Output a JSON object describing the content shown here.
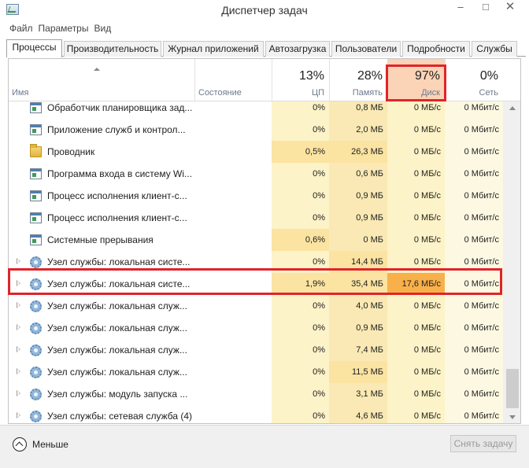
{
  "window": {
    "title": "Диспетчер задач",
    "minimize_glyph": "–",
    "maximize_glyph": "□",
    "close_glyph": "✕"
  },
  "menu": [
    "Файл",
    "Параметры",
    "Вид"
  ],
  "tabs": [
    "Процессы",
    "Производительность",
    "Журнал приложений",
    "Автозагрузка",
    "Пользователи",
    "Подробности",
    "Службы"
  ],
  "active_tab": "Процессы",
  "columns": {
    "name": "Имя",
    "status": "Состояние",
    "cpu": {
      "percent": "13%",
      "label": "ЦП"
    },
    "memory": {
      "percent": "28%",
      "label": "Память"
    },
    "disk": {
      "percent": "97%",
      "label": "Диск"
    },
    "network": {
      "percent": "0%",
      "label": "Сеть"
    }
  },
  "rows": [
    {
      "name": "Обработчик планировщика зад...",
      "icon": "app-window-icon",
      "expandable": false,
      "cpu": "0%",
      "memory": "0,8 МБ",
      "disk": "0 МБ/с",
      "network": "0 Мбит/с"
    },
    {
      "name": "Приложение служб и контрол...",
      "icon": "app-window-icon",
      "expandable": false,
      "cpu": "0%",
      "memory": "2,0 МБ",
      "disk": "0 МБ/с",
      "network": "0 Мбит/с"
    },
    {
      "name": "Проводник",
      "icon": "folder-icon",
      "expandable": false,
      "cpu": "0,5%",
      "memory": "26,3 МБ",
      "disk": "0 МБ/с",
      "network": "0 Мбит/с"
    },
    {
      "name": "Программа входа в систему Wi...",
      "icon": "app-window-icon",
      "expandable": false,
      "cpu": "0%",
      "memory": "0,6 МБ",
      "disk": "0 МБ/с",
      "network": "0 Мбит/с"
    },
    {
      "name": "Процесс исполнения клиент-с...",
      "icon": "app-window-icon",
      "expandable": false,
      "cpu": "0%",
      "memory": "0,9 МБ",
      "disk": "0 МБ/с",
      "network": "0 Мбит/с"
    },
    {
      "name": "Процесс исполнения клиент-с...",
      "icon": "app-window-icon",
      "expandable": false,
      "cpu": "0%",
      "memory": "0,9 МБ",
      "disk": "0 МБ/с",
      "network": "0 Мбит/с"
    },
    {
      "name": "Системные прерывания",
      "icon": "app-window-icon",
      "expandable": false,
      "cpu": "0,6%",
      "memory": "0 МБ",
      "disk": "0 МБ/с",
      "network": "0 Мбит/с"
    },
    {
      "name": "Узел службы: локальная систе...",
      "icon": "gear-icon",
      "expandable": true,
      "cpu": "0%",
      "memory": "14,4 МБ",
      "disk": "0 МБ/с",
      "network": "0 Мбит/с"
    },
    {
      "name": "Узел службы: локальная систе...",
      "icon": "gear-icon",
      "expandable": true,
      "cpu": "1,9%",
      "memory": "35,4 МБ",
      "disk": "17,6 МБ/с",
      "network": "0 Мбит/с"
    },
    {
      "name": "Узел службы: локальная служ...",
      "icon": "gear-icon",
      "expandable": true,
      "cpu": "0%",
      "memory": "4,0 МБ",
      "disk": "0 МБ/с",
      "network": "0 Мбит/с"
    },
    {
      "name": "Узел службы: локальная служ...",
      "icon": "gear-icon",
      "expandable": true,
      "cpu": "0%",
      "memory": "0,9 МБ",
      "disk": "0 МБ/с",
      "network": "0 Мбит/с"
    },
    {
      "name": "Узел службы: локальная служ...",
      "icon": "gear-icon",
      "expandable": true,
      "cpu": "0%",
      "memory": "7,4 МБ",
      "disk": "0 МБ/с",
      "network": "0 Мбит/с"
    },
    {
      "name": "Узел службы: локальная служ...",
      "icon": "gear-icon",
      "expandable": true,
      "cpu": "0%",
      "memory": "11,5 МБ",
      "disk": "0 МБ/с",
      "network": "0 Мбит/с"
    },
    {
      "name": "Узел службы: модуль запуска ...",
      "icon": "gear-icon",
      "expandable": true,
      "cpu": "0%",
      "memory": "3,1 МБ",
      "disk": "0 МБ/с",
      "network": "0 Мбит/с"
    },
    {
      "name": "Узел службы: сетевая служба (4)",
      "icon": "gear-icon",
      "expandable": true,
      "cpu": "0%",
      "memory": "4,6 МБ",
      "disk": "0 МБ/с",
      "network": "0 Мбит/с"
    }
  ],
  "footer": {
    "less_label": "Меньше",
    "end_task_label": "Снять задачу"
  },
  "colors": {
    "highlight_box": "#e0242a",
    "disk_header_bg": "#fbd3b6",
    "heavy_disk_cell": "#f8b14a"
  }
}
